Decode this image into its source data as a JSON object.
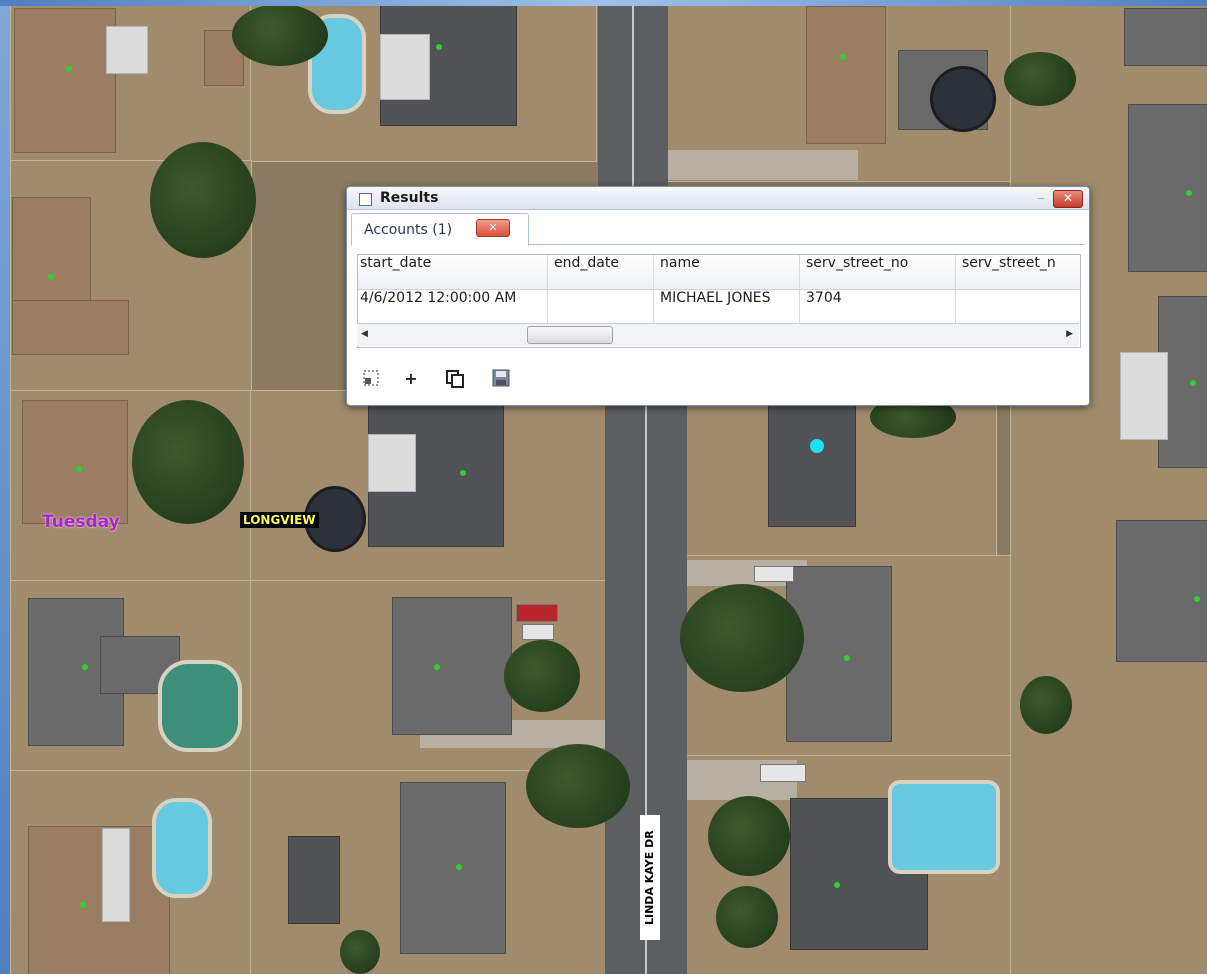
{
  "map": {
    "labels": {
      "tuesday": "Tuesday",
      "longview": "LONGVIEW",
      "street": "LINDA KAYE DR"
    }
  },
  "results_window": {
    "title": "Results",
    "tab_label": "Accounts (1)",
    "table": {
      "columns": [
        "start_date",
        "end_date",
        "name",
        "serv_street_no",
        "serv_street_n"
      ],
      "rows": [
        [
          "4/6/2012 12:00:00 AM",
          "",
          "MICHAEL JONES",
          "3704",
          ""
        ]
      ]
    },
    "toolbar": {
      "zoom_extent_icon": "zoom-extent-icon",
      "add_icon": "add-icon",
      "copy_icon": "copy-icon",
      "save_icon": "save-icon"
    }
  },
  "colors": {
    "tuesday_label": "#b01fd0",
    "longview_label_bg": "#000000",
    "longview_label_text": "#ffff55",
    "parcel_dot": "#2ed12e",
    "selected_dot": "#1fe0f0"
  }
}
